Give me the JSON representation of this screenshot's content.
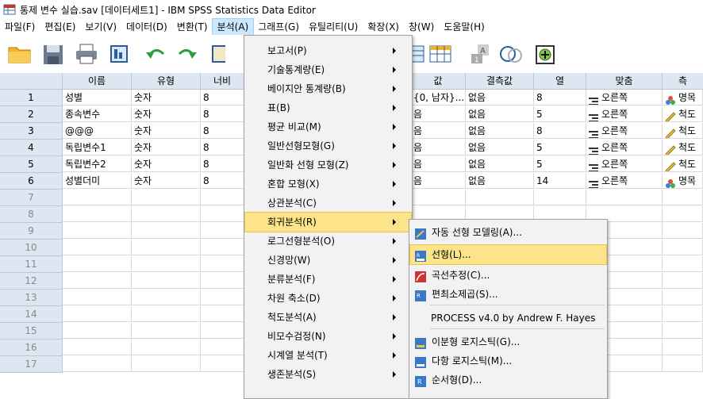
{
  "window": {
    "title": "통제 변수 실습.sav [데이터세트1] - IBM SPSS Statistics Data Editor"
  },
  "menubar": [
    {
      "label": "파일(F)"
    },
    {
      "label": "편집(E)"
    },
    {
      "label": "보기(V)"
    },
    {
      "label": "데이터(D)"
    },
    {
      "label": "변환(T)"
    },
    {
      "label": "분석(A)"
    },
    {
      "label": "그래프(G)"
    },
    {
      "label": "유틸리티(U)"
    },
    {
      "label": "확장(X)"
    },
    {
      "label": "창(W)"
    },
    {
      "label": "도움말(H)"
    }
  ],
  "grid": {
    "headers": [
      "이름",
      "유형",
      "너비",
      "값",
      "결측값",
      "열",
      "맞춤",
      "측"
    ],
    "rows": [
      {
        "num": "1",
        "name": "성별",
        "type": "숫자",
        "width": "8",
        "values": "{0, 남자}...",
        "missing": "없음",
        "columns": "8",
        "align": "오른쪽",
        "measure": "명목"
      },
      {
        "num": "2",
        "name": "종속변수",
        "type": "숫자",
        "width": "8",
        "values": "음",
        "missing": "없음",
        "columns": "5",
        "align": "오른쪽",
        "measure": "척도"
      },
      {
        "num": "3",
        "name": "@@@",
        "type": "숫자",
        "width": "8",
        "values": "음",
        "missing": "없음",
        "columns": "8",
        "align": "오른쪽",
        "measure": "척도"
      },
      {
        "num": "4",
        "name": "독립변수1",
        "type": "숫자",
        "width": "8",
        "values": "음",
        "missing": "없음",
        "columns": "5",
        "align": "오른쪽",
        "measure": "척도"
      },
      {
        "num": "5",
        "name": "독립변수2",
        "type": "숫자",
        "width": "8",
        "values": "음",
        "missing": "없음",
        "columns": "5",
        "align": "오른쪽",
        "measure": "척도"
      },
      {
        "num": "6",
        "name": "성별더미",
        "type": "숫자",
        "width": "8",
        "values": "음",
        "missing": "없음",
        "columns": "14",
        "align": "오른쪽",
        "measure": "명목"
      }
    ],
    "empty_rows": [
      "7",
      "8",
      "9",
      "10",
      "11",
      "12",
      "13",
      "14",
      "15",
      "16",
      "17"
    ]
  },
  "analyze_menu": [
    {
      "label": "보고서(P)"
    },
    {
      "label": "기술통계량(E)"
    },
    {
      "label": "베이지안 통계량(B)"
    },
    {
      "label": "표(B)"
    },
    {
      "label": "평균 비교(M)"
    },
    {
      "label": "일반선형모형(G)"
    },
    {
      "label": "일반화 선형 모형(Z)"
    },
    {
      "label": "혼합 모형(X)"
    },
    {
      "label": "상관분석(C)"
    },
    {
      "label": "회귀분석(R)"
    },
    {
      "label": "로그선형분석(O)"
    },
    {
      "label": "신경망(W)"
    },
    {
      "label": "분류분석(F)"
    },
    {
      "label": "차원 축소(D)"
    },
    {
      "label": "척도분석(A)"
    },
    {
      "label": "비모수검정(N)"
    },
    {
      "label": "시계열 분석(T)"
    },
    {
      "label": "생존분석(S)"
    }
  ],
  "regression_menu": [
    {
      "label": "자동 선형 모델링(A)...",
      "icon": "auto-linear-icon"
    },
    {
      "label": "선형(L)...",
      "icon": "linear-icon"
    },
    {
      "label": "곡선추정(C)...",
      "icon": "curve-icon"
    },
    {
      "label": "편최소제곱(S)...",
      "icon": "pls-icon"
    },
    {
      "label": "PROCESS v4.0 by Andrew F. Hayes",
      "icon": ""
    },
    {
      "label": "이분형 로지스틱(G)...",
      "icon": "binary-logistic-icon"
    },
    {
      "label": "다항 로지스틱(M)...",
      "icon": "multinomial-logistic-icon"
    },
    {
      "label": "순서형(D)...",
      "icon": "ordinal-icon"
    }
  ],
  "colors": {
    "menu_highlight": "#fde48b",
    "header_bg": "#dde6f1",
    "active_menu": "#cce8ff"
  }
}
